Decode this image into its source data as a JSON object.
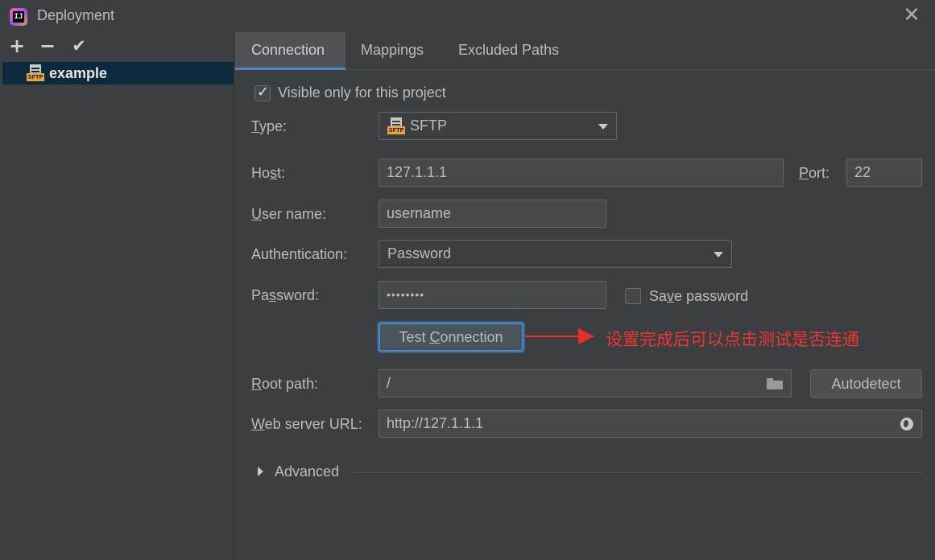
{
  "window": {
    "title": "Deployment",
    "app_icon_text": "IJ",
    "close_glyph": "✕"
  },
  "left_toolbar": {
    "add_glyph": "+",
    "remove_glyph": "−",
    "apply_glyph": "✔"
  },
  "server_list": {
    "items": [
      {
        "label": "example",
        "icon": "sftp-icon",
        "icon_text": "SFTP",
        "selected": true
      }
    ]
  },
  "tabs": [
    {
      "label": "Connection",
      "active": true
    },
    {
      "label": "Mappings",
      "active": false
    },
    {
      "label": "Excluded Paths",
      "active": false
    }
  ],
  "form": {
    "visible_only": {
      "label": "Visible only for this project",
      "checked": true
    },
    "type": {
      "label_mnemonic": "T",
      "label_rest": "ype:",
      "value": "SFTP",
      "icon_text": "SFTP"
    },
    "host": {
      "label_pre": "Ho",
      "label_mnemonic": "s",
      "label_rest": "t:",
      "value": "127.1.1.1"
    },
    "port": {
      "label_mnemonic": "P",
      "label_rest": "ort:",
      "value": "22"
    },
    "user_name": {
      "label_mnemonic": "U",
      "label_rest": "ser name:",
      "value": "username"
    },
    "authentication": {
      "label": "Authentication:",
      "value": "Password"
    },
    "password": {
      "label_pre": "Pa",
      "label_mnemonic": "s",
      "label_rest": "sword:",
      "value": "••••••••"
    },
    "save_password": {
      "label_pre": "Sa",
      "label_mnemonic": "v",
      "label_rest": "e password",
      "checked": false
    },
    "test_connection": {
      "label_pre": "Test ",
      "label_mnemonic": "C",
      "label_rest": "onnection"
    },
    "root_path": {
      "label_mnemonic": "R",
      "label_rest": "oot path:",
      "value": "/"
    },
    "autodetect": {
      "label": "Autodetect"
    },
    "web_server_url": {
      "label_mnemonic": "W",
      "label_rest": "eb server URL:",
      "value": "http://127.1.1.1"
    },
    "advanced": {
      "label": "Advanced"
    }
  },
  "annotation": {
    "text": "设置完成后可以点击测试是否连通",
    "color": "#e8302a"
  },
  "colors": {
    "background": "#3c3f41",
    "selection": "#0d293e",
    "accent": "#4a88c7"
  }
}
